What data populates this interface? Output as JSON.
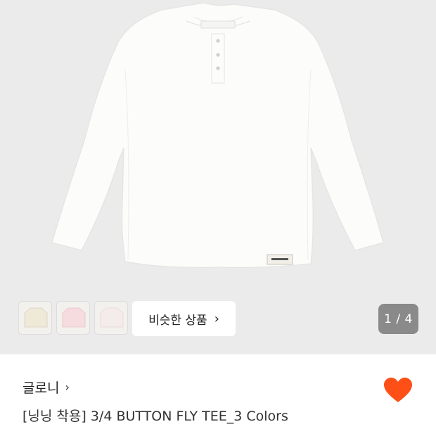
{
  "gallery": {
    "similar_button_label": "비슷한 상품",
    "similar_button_chevron": "›",
    "counter": "1 / 4",
    "thumbnails": [
      {
        "color": "#efe9d8"
      },
      {
        "color": "#f6dcdf"
      },
      {
        "color": "#f5ebea"
      }
    ]
  },
  "product": {
    "brand": "글로니",
    "brand_chevron": "›",
    "title": "[닝닝 착용] 3/4 BUTTON FLY TEE_3 Colors",
    "liked": true,
    "accent_color": "#fe4f16"
  },
  "icons": {
    "heart": "heart-icon",
    "chevron": "chevron-right-icon"
  }
}
